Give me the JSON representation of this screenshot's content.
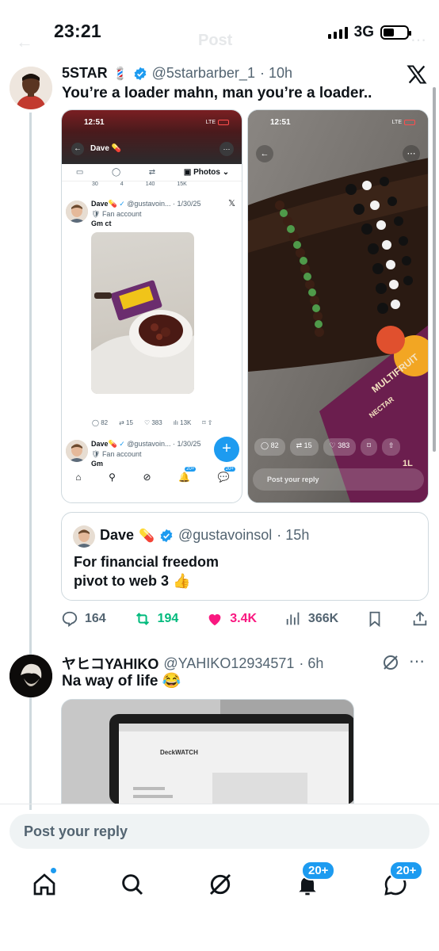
{
  "status_bar": {
    "time": "23:21",
    "network": "3G"
  },
  "header": {
    "title": "Post"
  },
  "main_post": {
    "display_name": "5STAR",
    "name_emoji": "💈",
    "handle": "@5starbarber_1",
    "time": "· 10h",
    "text": "You’re a loader mahn, man you’re a loader..",
    "source_icon": "x-logo-icon",
    "media_left": {
      "time": "12:51",
      "network": "LTE",
      "header_name": "Dave",
      "tabs": {
        "photos": "Photos"
      },
      "stub_counts": [
        "30",
        "4",
        "140",
        "15K"
      ],
      "tweet1": {
        "name": "Dave",
        "handle": "@gustavoin...",
        "date": "· 1/30/25",
        "badge": "Fan account",
        "text": "Gm ct",
        "stats": [
          "82",
          "15",
          "383",
          "13K"
        ]
      },
      "tweet2": {
        "name": "Dave",
        "handle": "@gustavoin...",
        "date": "· 1/30/25",
        "badge": "Fan account",
        "text": "Gm"
      },
      "nav_badges": [
        "20+",
        "20+"
      ]
    },
    "media_right": {
      "time": "12:51",
      "network": "LTE",
      "stats": [
        "82",
        "15",
        "383"
      ],
      "reply_placeholder": "Post your reply",
      "juice_text": "MULTIFRUIT",
      "juice_sub": "NECTAR",
      "juice_size": "1L"
    },
    "quote": {
      "display_name": "Dave",
      "name_emoji": "💊",
      "handle": "@gustavoinsol",
      "time": "· 15h",
      "text_line1": "For financial freedom",
      "text_line2": "pivot to web 3 👍"
    },
    "actions": {
      "replies": "164",
      "reposts": "194",
      "likes": "3.4K",
      "views": "366K"
    },
    "colors": {
      "repost": "#00ba7c",
      "like": "#f91880",
      "accent": "#1d9bf0"
    }
  },
  "reply_post": {
    "display_name": "ヤヒコYAHIKO",
    "handle": "@YAHIKO12934571",
    "time": "· 6h",
    "text": "Na way of life 😂",
    "screen_brand": "DeckWATCH"
  },
  "reply_bar": {
    "placeholder": "Post your reply"
  },
  "bottom_nav": {
    "notifications_badge": "20+",
    "messages_badge": "20+"
  }
}
